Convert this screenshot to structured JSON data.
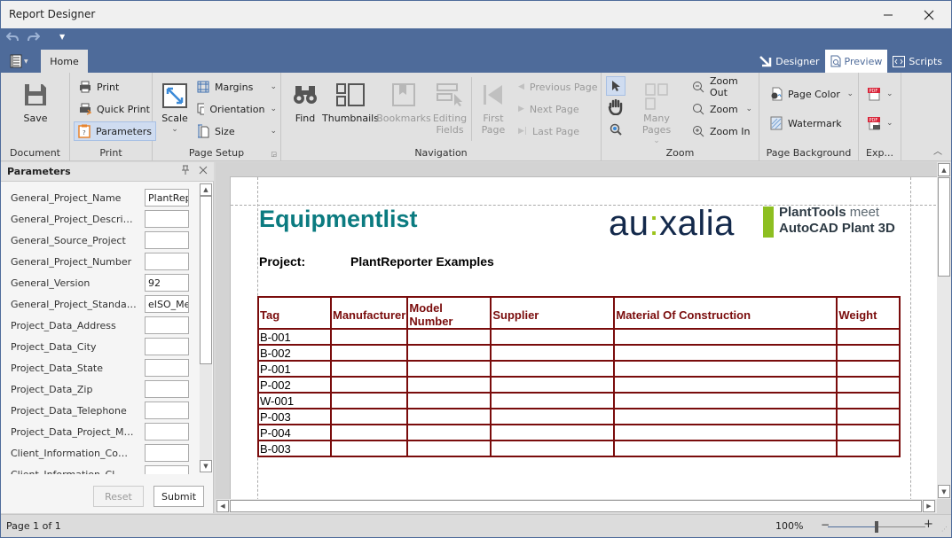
{
  "window": {
    "title": "Report Designer",
    "minimize_icon": "minimize-icon",
    "maximize_icon": "maximize-icon",
    "close_icon": "close-icon"
  },
  "quick_access": {
    "undo_icon": "undo-icon",
    "redo_icon": "redo-icon",
    "customize_icon": "dropdown-arrow-icon"
  },
  "tabs": {
    "home": "Home"
  },
  "view_tabs": [
    {
      "label": "Designer",
      "icon": "designer-icon",
      "active": false
    },
    {
      "label": "Preview",
      "icon": "preview-icon",
      "active": true
    },
    {
      "label": "Scripts",
      "icon": "scripts-icon",
      "active": false
    }
  ],
  "ribbon": {
    "document": {
      "label": "Document",
      "save": "Save"
    },
    "print": {
      "label": "Print",
      "print": "Print",
      "quick_print": "Quick Print",
      "parameters": "Parameters"
    },
    "page_setup": {
      "label": "Page Setup",
      "scale": "Scale",
      "margins": "Margins",
      "orientation": "Orientation",
      "size": "Size"
    },
    "navigation": {
      "label": "Navigation",
      "find": "Find",
      "thumbnails": "Thumbnails",
      "bookmarks": "Bookmarks",
      "editing_fields_1": "Editing",
      "editing_fields_2": "Fields",
      "first_page_1": "First",
      "first_page_2": "Page",
      "previous_page": "Previous Page",
      "next_page": "Next  Page",
      "last_page": "Last  Page"
    },
    "zoom": {
      "label": "Zoom",
      "many_pages": "Many Pages",
      "zoom_out": "Zoom Out",
      "zoom": "Zoom",
      "zoom_in": "Zoom In"
    },
    "page_background": {
      "label": "Page Background",
      "page_color": "Page Color",
      "watermark": "Watermark"
    },
    "export": {
      "label": "Exp..."
    }
  },
  "parameters_panel": {
    "title": "Parameters",
    "pin_icon": "pin-icon",
    "close_icon": "close-icon",
    "params": [
      {
        "name": "General_Project_Name",
        "value": "PlantRep"
      },
      {
        "name": "General_Project_Description",
        "value": ""
      },
      {
        "name": "General_Source_Project",
        "value": ""
      },
      {
        "name": "General_Project_Number",
        "value": ""
      },
      {
        "name": "General_Version",
        "value": "92"
      },
      {
        "name": "General_Project_Standard",
        "value": "eISO_Me"
      },
      {
        "name": "Project_Data_Address",
        "value": ""
      },
      {
        "name": "Project_Data_City",
        "value": ""
      },
      {
        "name": "Project_Data_State",
        "value": ""
      },
      {
        "name": "Project_Data_Zip",
        "value": ""
      },
      {
        "name": "Project_Data_Telephone",
        "value": ""
      },
      {
        "name": "Project_Data_Project_Man...",
        "value": ""
      },
      {
        "name": "Client_Information_Compa...",
        "value": ""
      },
      {
        "name": "Client_Information_Cl...",
        "value": ""
      }
    ],
    "reset": "Reset",
    "submit": "Submit"
  },
  "report": {
    "title": "Equipmentlist",
    "project_label": "Project:",
    "project_value": "PlantReporter Examples",
    "logo": {
      "brand_a": "au",
      "brand_sep": ":",
      "brand_b": "xalia",
      "line1_bold": "PlantTools",
      "line1_light": " meet",
      "line2": "AutoCAD Plant 3D"
    },
    "colors": {
      "title": "#0b7b80",
      "table_border": "#7a0c0c",
      "logo_green": "#8dbf21",
      "logo_navy": "#13294b"
    },
    "columns": [
      "Tag",
      "Manufacturer",
      "Model Number",
      "Supplier",
      "Material Of Construction",
      "Weight"
    ],
    "rows": [
      [
        "B-001",
        "",
        "",
        "",
        "",
        ""
      ],
      [
        "B-002",
        "",
        "",
        "",
        "",
        ""
      ],
      [
        "P-001",
        "",
        "",
        "",
        "",
        ""
      ],
      [
        "P-002",
        "",
        "",
        "",
        "",
        ""
      ],
      [
        "W-001",
        "",
        "",
        "",
        "",
        ""
      ],
      [
        "P-003",
        "",
        "",
        "",
        "",
        ""
      ],
      [
        "P-004",
        "",
        "",
        "",
        "",
        ""
      ],
      [
        "B-003",
        "",
        "",
        "",
        "",
        ""
      ]
    ]
  },
  "status_bar": {
    "page_info": "Page 1 of 1",
    "zoom_percent": "100%",
    "zoom_slider_fraction": 0.5
  },
  "accent_color": "#4e6b9a"
}
